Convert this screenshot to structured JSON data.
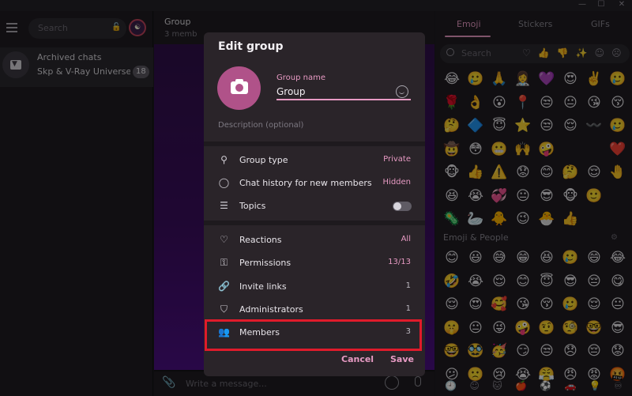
{
  "left": {
    "search_placeholder": "Search",
    "archive": {
      "title": "Archived chats",
      "subtitle": "Skp & V-Ray Universe Gl...",
      "badge": "18"
    }
  },
  "chat": {
    "title": "Group",
    "subtitle": "3 memb",
    "input_placeholder": "Write a message..."
  },
  "emoji_panel": {
    "tabs": [
      "Emoji",
      "Stickers",
      "GIFs"
    ],
    "search_placeholder": "Search",
    "section_title": "Emoji & People",
    "recent": [
      "😂",
      "🥲",
      "🙏",
      "👩‍⚕️",
      "💜",
      "😍",
      "✌️",
      "🥲",
      "🌹",
      "👌",
      "😮",
      "📍",
      "😒",
      "😐",
      "😘",
      "😚",
      "🤔",
      "🔷",
      "😇",
      "⭐",
      "😒",
      "😌",
      "〰️",
      "🥲",
      "🤠",
      "😳",
      "😬",
      "🙌",
      "🤪",
      "",
      "",
      "❤️",
      "🐵",
      "👍",
      "⚠️",
      "😟",
      "😊",
      "🤔",
      "😌",
      "🤚",
      "😆",
      "😭",
      "💞",
      "😐",
      "😎",
      "🐵",
      "🙂",
      "",
      "🦠",
      "🦢",
      "🐥",
      "😉",
      "🐣",
      "👍",
      "",
      ""
    ],
    "people": [
      "😊",
      "😃",
      "😅",
      "😁",
      "😆",
      "🥲",
      "😄",
      "😂",
      "🤣",
      "😭",
      "😌",
      "😊",
      "😇",
      "😎",
      "😔",
      "😋",
      "😌",
      "😍",
      "🥰",
      "😘",
      "😚",
      "🥲",
      "😌",
      "😐",
      "🤫",
      "😐",
      "😜",
      "🤪",
      "🤨",
      "🧐",
      "🤓",
      "😎",
      "🤓",
      "🥸",
      "🥳",
      "😏",
      "😒",
      "😞",
      "😔",
      "😟",
      "😕",
      "🙁",
      "😢",
      "😭",
      "😤",
      "😠",
      "😡",
      "🤬"
    ]
  },
  "modal": {
    "title": "Edit group",
    "name_label": "Group name",
    "name_value": "Group",
    "description_placeholder": "Description (optional)",
    "settings": [
      {
        "label": "Group type",
        "value": "Private"
      },
      {
        "label": "Chat history for new members",
        "value": "Hidden"
      },
      {
        "label": "Topics",
        "value": ""
      }
    ],
    "management": [
      {
        "label": "Reactions",
        "value": "All"
      },
      {
        "label": "Permissions",
        "value": "13/13"
      },
      {
        "label": "Invite links",
        "value": "1"
      },
      {
        "label": "Administrators",
        "value": "1"
      },
      {
        "label": "Members",
        "value": "3"
      }
    ],
    "cancel_label": "Cancel",
    "save_label": "Save"
  },
  "colors": {
    "accent": "#e79ac3",
    "avatar": "#b05289",
    "highlight": "#e01b2b"
  }
}
